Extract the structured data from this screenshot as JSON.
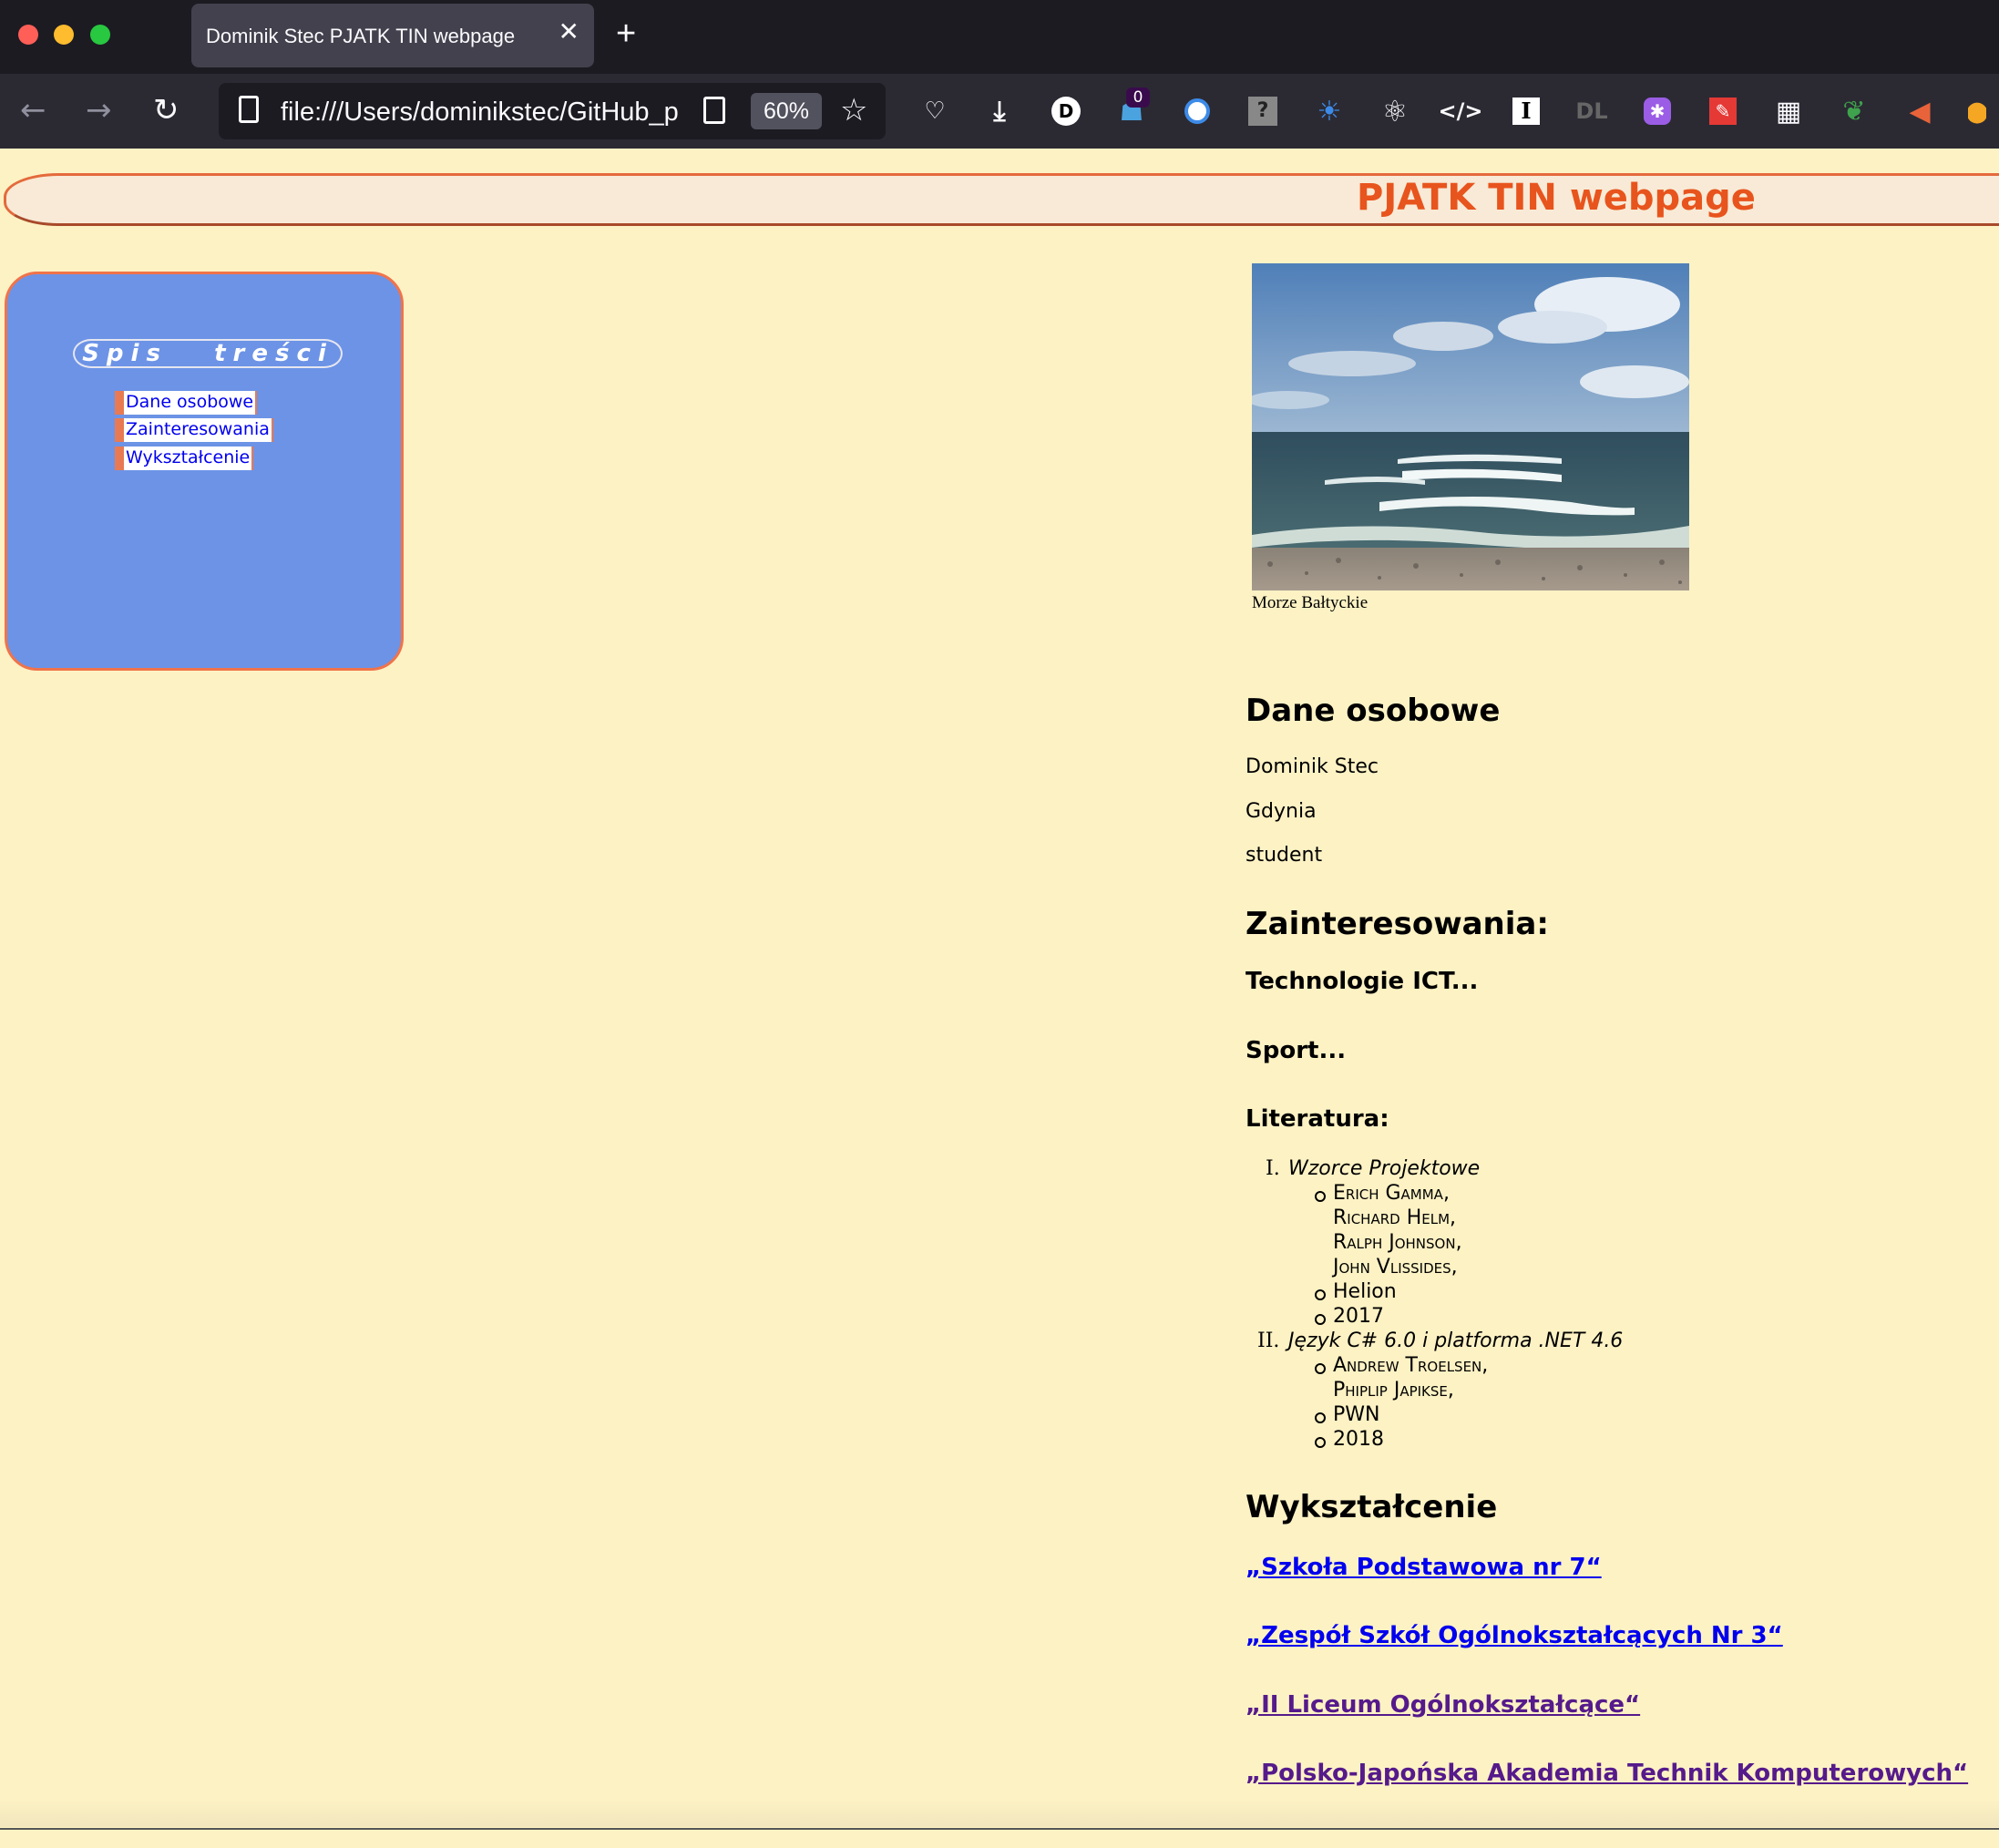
{
  "browser": {
    "tab_title": "Dominik Stec PJATK TIN webpage",
    "tab_close": "✕",
    "new_tab": "+",
    "url": "file:///Users/dominikstec/GitHub_p",
    "zoom": "60%",
    "badge_count": "0",
    "traffic_lights": {
      "close": "#ff5f57",
      "minimize": "#febc2e",
      "maximize": "#28c840"
    }
  },
  "header": {
    "title": "PJATK TIN webpage"
  },
  "toc": {
    "title": "Spis   treści",
    "items": [
      "Dane osobowe",
      "Zainteresowania",
      "Wykształcenie"
    ]
  },
  "photo": {
    "caption": "Morze Bałtyckie"
  },
  "personal": {
    "heading": "Dane osobowe",
    "name": "Dominik Stec",
    "city": "Gdynia",
    "occupation": "student"
  },
  "interests": {
    "heading": "Zainteresowania:",
    "items": [
      "Technologie ICT...",
      "Sport...",
      "Literatura:"
    ]
  },
  "literature": [
    {
      "num": "I.",
      "title": "Wzorce Projektowe",
      "authors": [
        "Erich Gamma,",
        "Richard Helm,",
        "Ralph Johnson,",
        "John Vlissides,"
      ],
      "publisher": "Helion",
      "year": "2017"
    },
    {
      "num": "II.",
      "title": "Język C# 6.0 i platforma .NET 4.6",
      "authors": [
        "Andrew Troelsen,",
        "Phiplip Japikse,"
      ],
      "publisher": "PWN",
      "year": "2018"
    }
  ],
  "education": {
    "heading": "Wykształcenie",
    "links": [
      {
        "text": "„Szkoła Podstawowa nr 7“",
        "color": "#0000ee"
      },
      {
        "text": "„Zespół Szkół Ogólnokształcących Nr 3“",
        "color": "#0000ee"
      },
      {
        "text": "„II Liceum Ogólnokształcące“",
        "color": "#551a8b"
      },
      {
        "text": "„Polsko-Japońska Akademia Technik Komputerowych“",
        "color": "#551a8b"
      }
    ]
  },
  "colors": {
    "page_bg": "#fdf2c4",
    "title": "#e8541d",
    "toc_bg": "#6c93e6",
    "toc_border": "#f0734a"
  }
}
